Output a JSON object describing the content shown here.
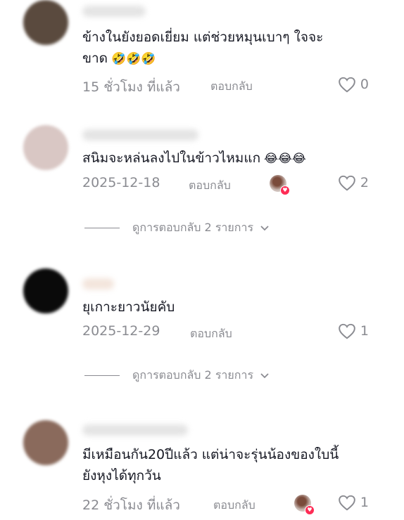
{
  "comments": [
    {
      "text": "ข้างในยังยอดเยี่ยม แต่ช่วยหมุนเบาๆ ใจจะ\nขาด",
      "emojis": "🤣🤣🤣",
      "time": "15 ชั่วโมง ที่แล้ว",
      "reply_label": "ตอบกลับ",
      "likes": "0",
      "avatar_color": "#5a4a3e"
    },
    {
      "text": "สนิมจะหล่นลงไปในข้าวไหมแก",
      "emojis": "😂😂😂",
      "time": "2025-12-18",
      "reply_label": "ตอบกลับ",
      "likes": "2",
      "avatar_color": "#d9c7c4",
      "view_replies": "ดูการตอบกลับ 2 รายการ"
    },
    {
      "text": "ยุเกาะยาวนัยคับ",
      "emojis": "",
      "time": "2025-12-29",
      "reply_label": "ตอบกลับ",
      "likes": "1",
      "avatar_color": "#0a0a0a",
      "view_replies": "ดูการตอบกลับ 2 รายการ"
    },
    {
      "text": "มีเหมือนกัน20ปีแล้ว แต่น่าจะรุ่นน้องของใบนี้\nยังหุงได้ทุกวัน",
      "emojis": "",
      "time": "22 ชั่วโมง ที่แล้ว",
      "reply_label": "ตอบกลับ",
      "likes": "1",
      "avatar_color": "#8a6a5c"
    }
  ]
}
